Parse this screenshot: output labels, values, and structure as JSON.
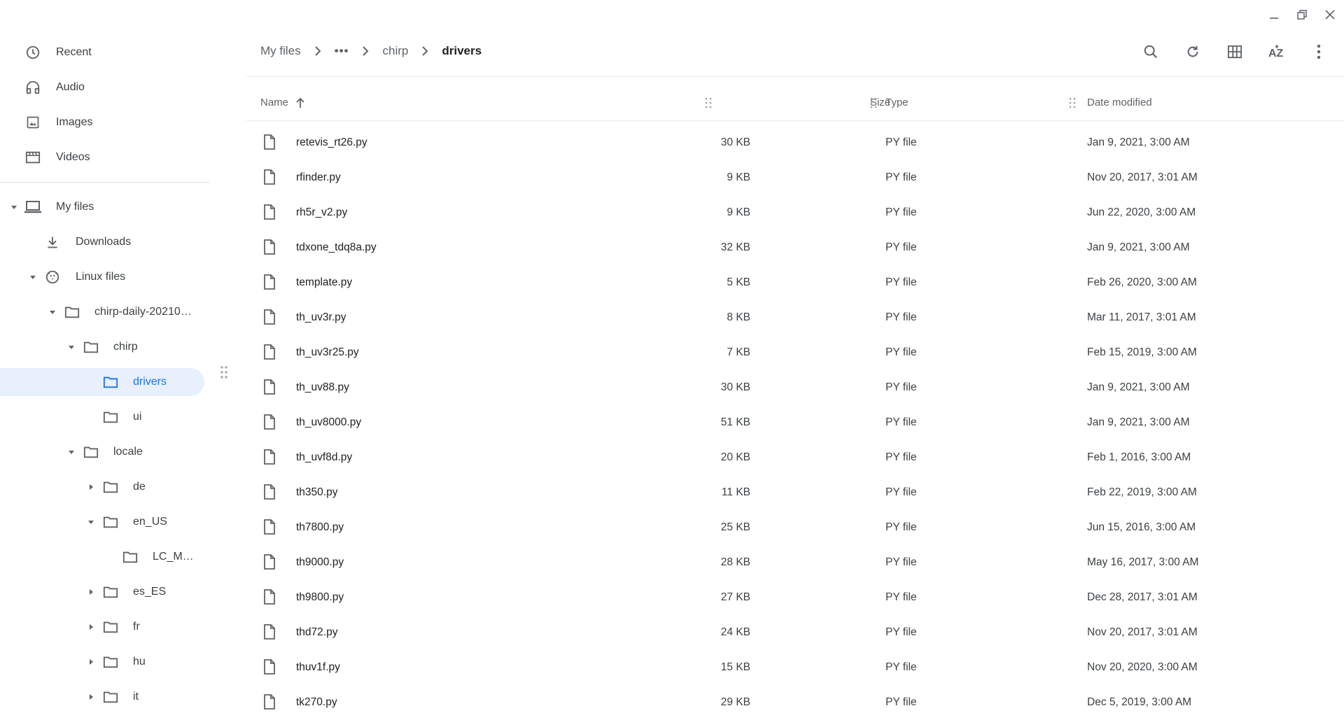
{
  "window": {
    "controls": [
      "minimize-icon",
      "restore-icon",
      "close-icon"
    ]
  },
  "sidebar": {
    "recent": "Recent",
    "audio": "Audio",
    "images": "Images",
    "videos": "Videos",
    "my_files": "My files",
    "downloads": "Downloads",
    "linux_files": "Linux files",
    "chirp_daily": "chirp-daily-20210…",
    "chirp": "chirp",
    "drivers": "drivers",
    "ui": "ui",
    "locale": "locale",
    "de": "de",
    "en_US": "en_US",
    "lc_m": "LC_M…",
    "es_ES": "es_ES",
    "fr": "fr",
    "hu": "hu",
    "it": "it"
  },
  "breadcrumb": {
    "root": "My files",
    "ellipsis": "•••",
    "parent": "chirp",
    "current": "drivers"
  },
  "toolbar": [
    "search-icon",
    "refresh-icon",
    "grid-view-icon",
    "sort-az-icon",
    "more-vert-icon"
  ],
  "columns": {
    "name": "Name",
    "size": "Size",
    "type": "Type",
    "date": "Date modified"
  },
  "files": [
    {
      "name": "retevis_rt26.py",
      "size": "30 KB",
      "type": "PY file",
      "date": "Jan 9, 2021, 3:00 AM"
    },
    {
      "name": "rfinder.py",
      "size": "9 KB",
      "type": "PY file",
      "date": "Nov 20, 2017, 3:01 AM"
    },
    {
      "name": "rh5r_v2.py",
      "size": "9 KB",
      "type": "PY file",
      "date": "Jun 22, 2020, 3:00 AM"
    },
    {
      "name": "tdxone_tdq8a.py",
      "size": "32 KB",
      "type": "PY file",
      "date": "Jan 9, 2021, 3:00 AM"
    },
    {
      "name": "template.py",
      "size": "5 KB",
      "type": "PY file",
      "date": "Feb 26, 2020, 3:00 AM"
    },
    {
      "name": "th_uv3r.py",
      "size": "8 KB",
      "type": "PY file",
      "date": "Mar 11, 2017, 3:01 AM"
    },
    {
      "name": "th_uv3r25.py",
      "size": "7 KB",
      "type": "PY file",
      "date": "Feb 15, 2019, 3:00 AM"
    },
    {
      "name": "th_uv88.py",
      "size": "30 KB",
      "type": "PY file",
      "date": "Jan 9, 2021, 3:00 AM"
    },
    {
      "name": "th_uv8000.py",
      "size": "51 KB",
      "type": "PY file",
      "date": "Jan 9, 2021, 3:00 AM"
    },
    {
      "name": "th_uvf8d.py",
      "size": "20 KB",
      "type": "PY file",
      "date": "Feb 1, 2016, 3:00 AM"
    },
    {
      "name": "th350.py",
      "size": "11 KB",
      "type": "PY file",
      "date": "Feb 22, 2019, 3:00 AM"
    },
    {
      "name": "th7800.py",
      "size": "25 KB",
      "type": "PY file",
      "date": "Jun 15, 2016, 3:00 AM"
    },
    {
      "name": "th9000.py",
      "size": "28 KB",
      "type": "PY file",
      "date": "May 16, 2017, 3:00 AM"
    },
    {
      "name": "th9800.py",
      "size": "27 KB",
      "type": "PY file",
      "date": "Dec 28, 2017, 3:01 AM"
    },
    {
      "name": "thd72.py",
      "size": "24 KB",
      "type": "PY file",
      "date": "Nov 20, 2017, 3:01 AM"
    },
    {
      "name": "thuv1f.py",
      "size": "15 KB",
      "type": "PY file",
      "date": "Nov 20, 2020, 3:00 AM"
    },
    {
      "name": "tk270.py",
      "size": "29 KB",
      "type": "PY file",
      "date": "Dec 5, 2019, 3:00 AM"
    }
  ],
  "colors": {
    "accent": "#1a73e8",
    "selected_bg": "#e8f0fe",
    "icon": "#5f6368"
  }
}
